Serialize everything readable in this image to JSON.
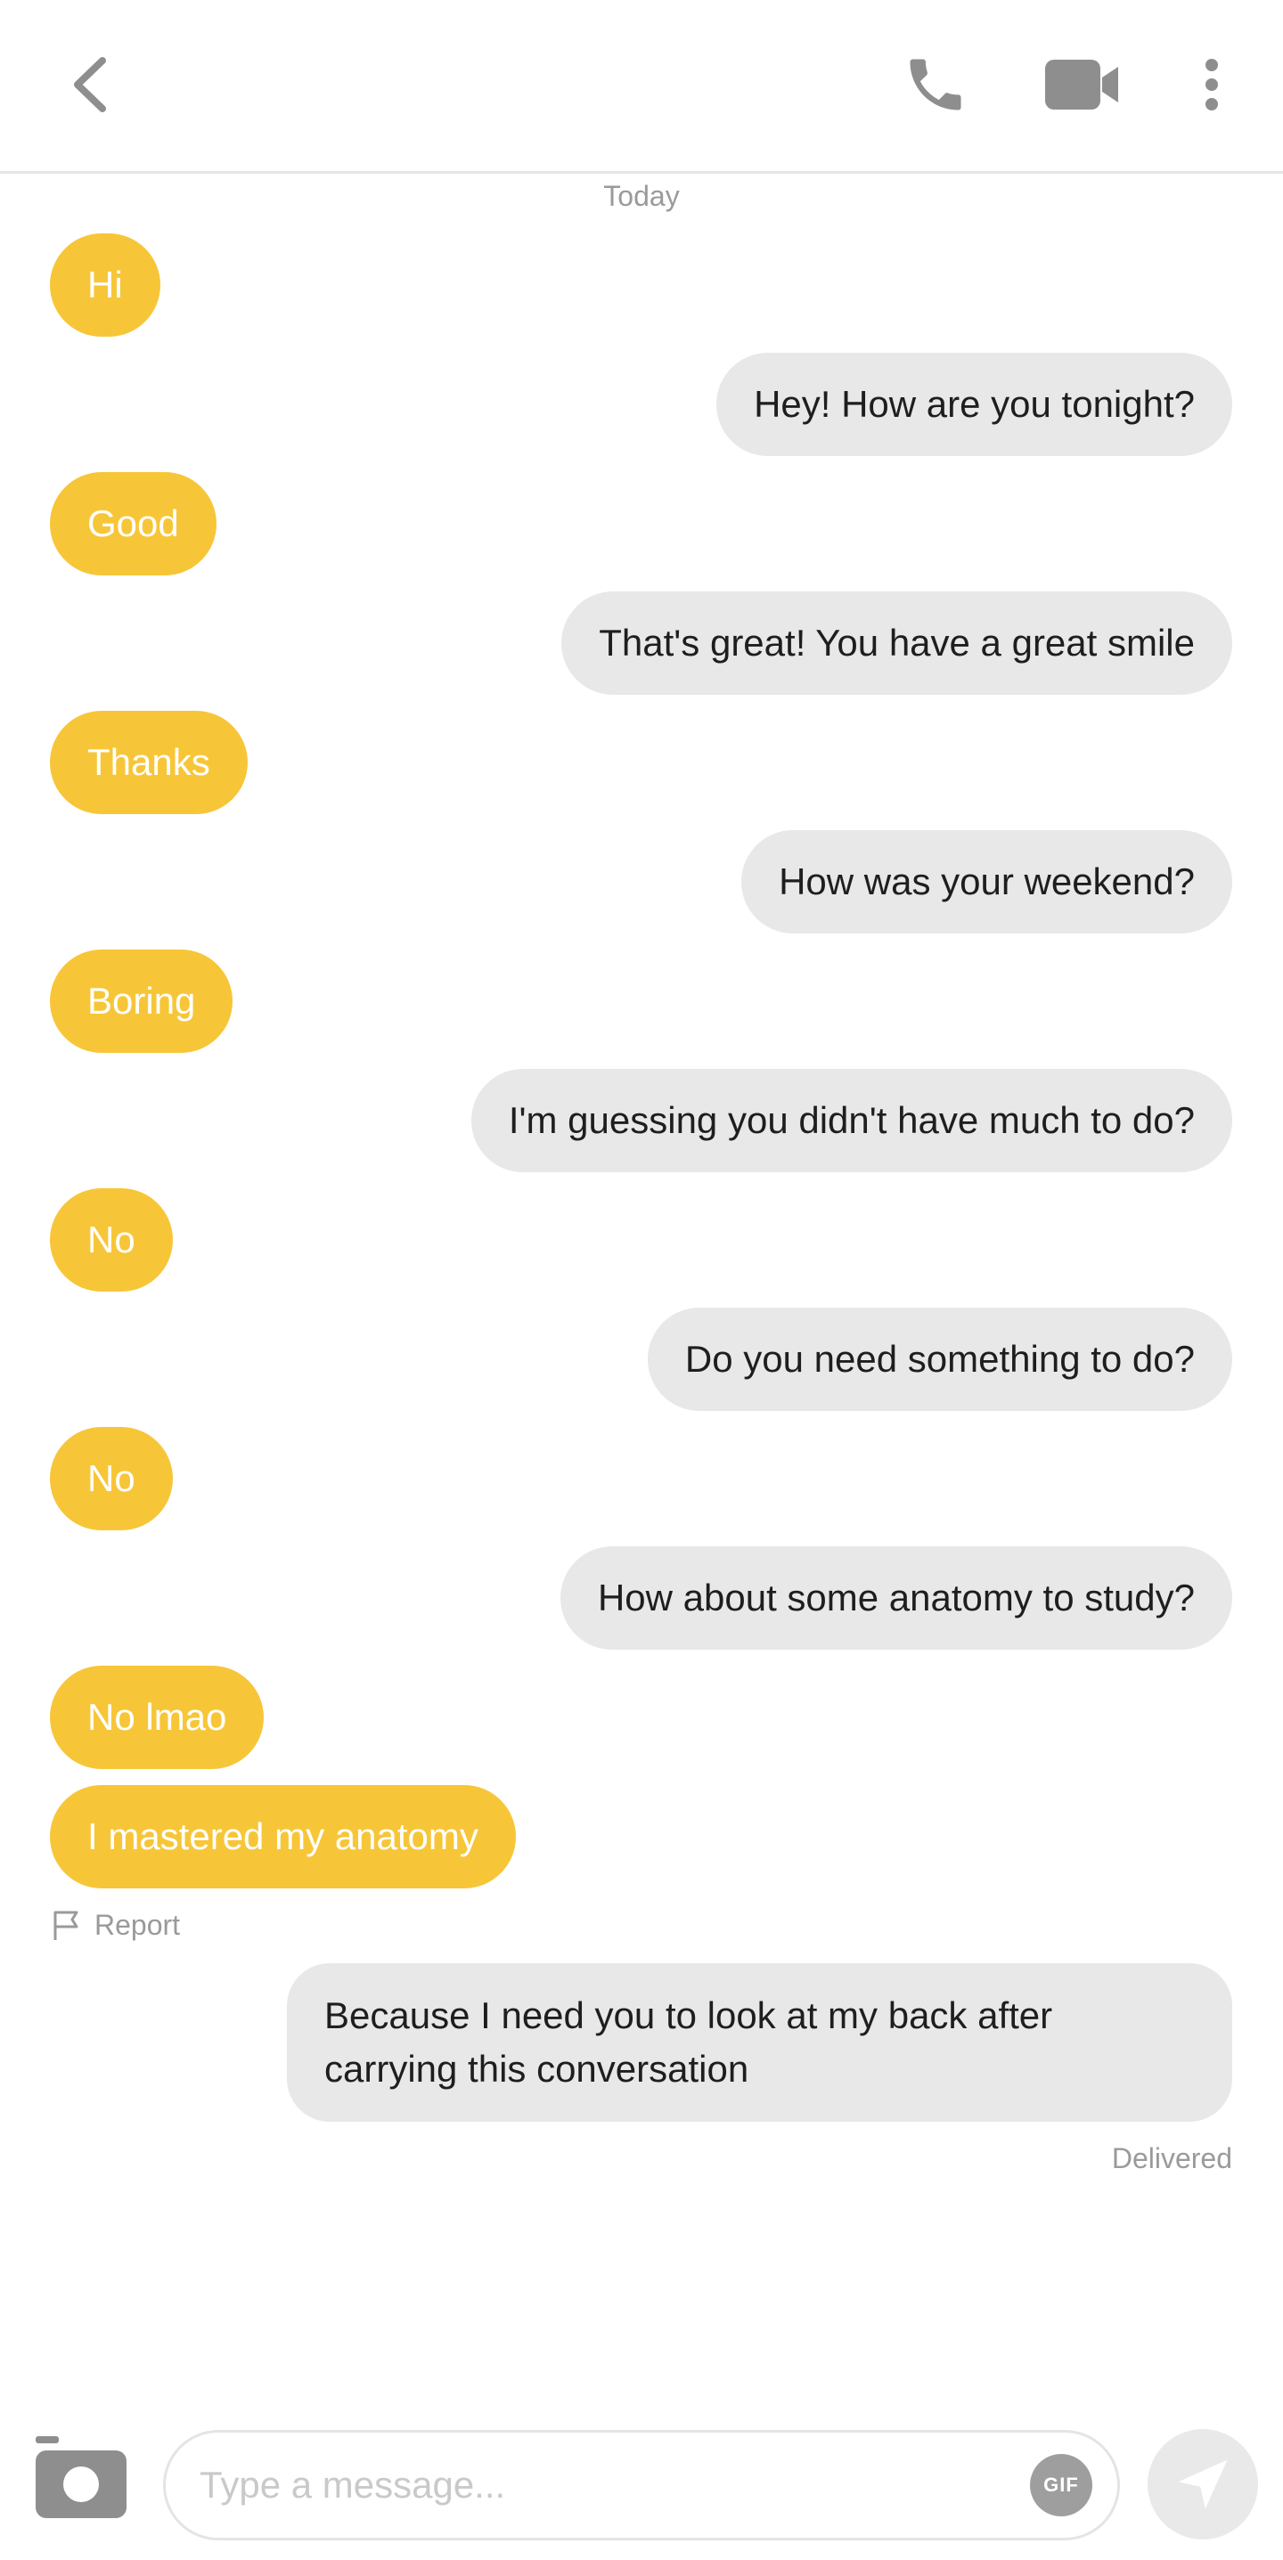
{
  "header": {
    "back_icon": "chevron-left-icon",
    "call_icon": "phone-icon",
    "video_icon": "video-camera-icon",
    "more_icon": "more-vertical-icon"
  },
  "date_separator": "Today",
  "messages": [
    {
      "from": "them",
      "text": "Hi"
    },
    {
      "from": "me",
      "text": "Hey! How are you tonight?"
    },
    {
      "from": "them",
      "text": "Good"
    },
    {
      "from": "me",
      "text": "That's great! You have a great smile"
    },
    {
      "from": "them",
      "text": "Thanks"
    },
    {
      "from": "me",
      "text": "How was your weekend?"
    },
    {
      "from": "them",
      "text": "Boring"
    },
    {
      "from": "me",
      "text": "I'm guessing you didn't have much to do?"
    },
    {
      "from": "them",
      "text": "No"
    },
    {
      "from": "me",
      "text": "Do you need something to do?"
    },
    {
      "from": "them",
      "text": "No"
    },
    {
      "from": "me",
      "text": "How about some anatomy to study?"
    },
    {
      "from": "them",
      "text": "No lmao"
    },
    {
      "from": "them",
      "text": "I mastered my anatomy"
    },
    {
      "from": "me",
      "text": "Because I need you to look at my back after carrying this conversation"
    }
  ],
  "report_label": "Report",
  "delivery_status": "Delivered",
  "composer": {
    "placeholder": "Type a message...",
    "gif_label": "GIF",
    "camera_icon": "camera-icon",
    "send_icon": "send-icon"
  },
  "colors": {
    "them_bubble": "#f7c638",
    "me_bubble": "#e8e8e8",
    "icon_gray": "#9a9a9a"
  }
}
